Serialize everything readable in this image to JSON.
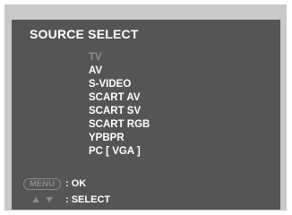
{
  "colors": {
    "outer_frame": "#c9c9c9",
    "panel_background": "#555555",
    "text": "#ffffff",
    "disabled_text": "#8e8e8e",
    "key_outline": "#8a8a8a"
  },
  "title": "SOURCE SELECT",
  "sources": [
    {
      "label": "TV",
      "state": "disabled"
    },
    {
      "label": "AV",
      "state": "enabled"
    },
    {
      "label": "S-VIDEO",
      "state": "enabled"
    },
    {
      "label": "SCART AV",
      "state": "enabled"
    },
    {
      "label": "SCART SV",
      "state": "enabled"
    },
    {
      "label": "SCART RGB",
      "state": "enabled"
    },
    {
      "label": "YPBPR",
      "state": "enabled"
    },
    {
      "label": "PC [ VGA ]",
      "state": "enabled"
    }
  ],
  "hints": {
    "ok": {
      "key_label": "MENU",
      "text": ": OK"
    },
    "select": {
      "key_icons": [
        "up-arrow-icon",
        "down-arrow-icon"
      ],
      "text": ": SELECT"
    }
  }
}
